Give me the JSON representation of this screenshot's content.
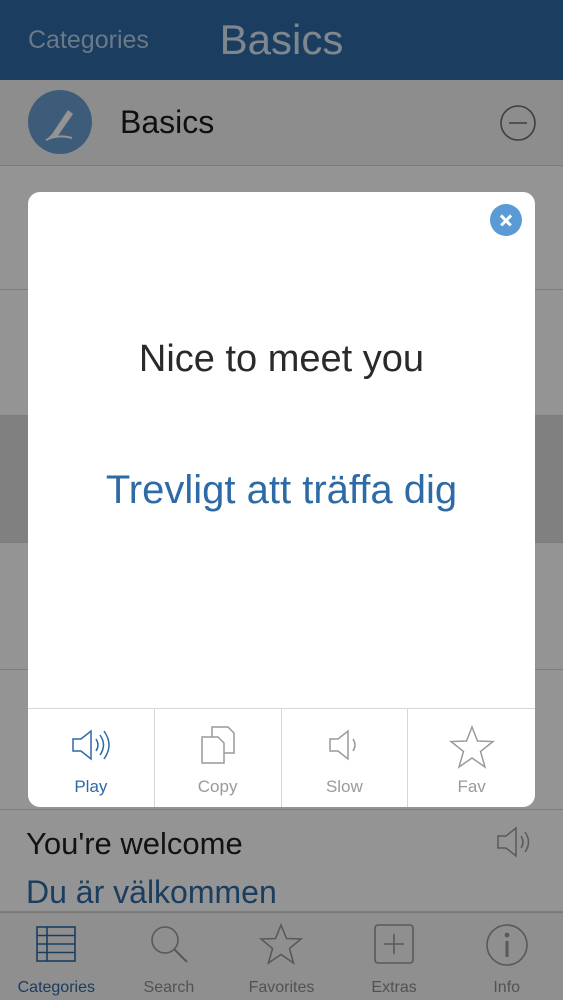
{
  "navbar": {
    "back_label": "Categories",
    "title": "Basics"
  },
  "category": {
    "label": "Basics"
  },
  "visible_row": {
    "phrase": "You're welcome",
    "translation": "Du är välkommen"
  },
  "modal": {
    "phrase": "Nice to meet you",
    "translation": "Trevligt att träffa dig",
    "actions": [
      {
        "label": "Play",
        "icon": "speaker-icon"
      },
      {
        "label": "Copy",
        "icon": "copy-icon"
      },
      {
        "label": "Slow",
        "icon": "speaker-slow-icon"
      },
      {
        "label": "Fav",
        "icon": "star-icon"
      }
    ]
  },
  "tabs": [
    {
      "label": "Categories",
      "icon": "list-icon",
      "active": true
    },
    {
      "label": "Search",
      "icon": "magnifier-icon",
      "active": false
    },
    {
      "label": "Favorites",
      "icon": "star-icon",
      "active": false
    },
    {
      "label": "Extras",
      "icon": "plus-box-icon",
      "active": false
    },
    {
      "label": "Info",
      "icon": "info-icon",
      "active": false
    }
  ],
  "colors": {
    "brand_blue": "#2d6aa6",
    "accent_light_blue": "#5b9bd5",
    "inactive_gray": "#8e8e8e"
  }
}
